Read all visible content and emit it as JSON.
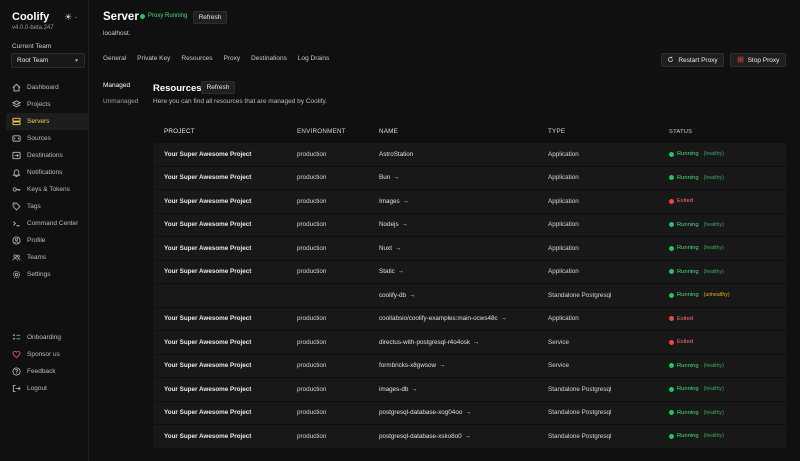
{
  "app": {
    "name": "Coolify",
    "version": "v4.0.0-beta.247"
  },
  "team": {
    "label": "Current Team",
    "value": "Root Team"
  },
  "nav": {
    "items": [
      {
        "label": "Dashboard",
        "icon": "home-icon"
      },
      {
        "label": "Projects",
        "icon": "layers-icon"
      },
      {
        "label": "Servers",
        "icon": "server-icon",
        "active": true
      },
      {
        "label": "Sources",
        "icon": "source-icon"
      },
      {
        "label": "Destinations",
        "icon": "destination-icon"
      },
      {
        "label": "Notifications",
        "icon": "bell-icon"
      },
      {
        "label": "Keys & Tokens",
        "icon": "key-icon"
      },
      {
        "label": "Tags",
        "icon": "tag-icon"
      },
      {
        "label": "Command Center",
        "icon": "terminal-icon"
      },
      {
        "label": "Profile",
        "icon": "user-icon"
      },
      {
        "label": "Teams",
        "icon": "users-icon"
      },
      {
        "label": "Settings",
        "icon": "gear-icon"
      }
    ],
    "bottom": [
      {
        "label": "Onboarding",
        "icon": "checklist-icon"
      },
      {
        "label": "Sponsor us",
        "icon": "heart-icon"
      },
      {
        "label": "Feedback",
        "icon": "help-icon"
      },
      {
        "label": "Logout",
        "icon": "logout-icon"
      }
    ]
  },
  "header": {
    "title": "Server",
    "proxy_status": "Proxy Running",
    "refresh_label": "Refresh",
    "host": "localhost."
  },
  "tabs": [
    "General",
    "Private Key",
    "Resources",
    "Proxy",
    "Destinations",
    "Log Drains"
  ],
  "actions": {
    "restart": "Restart Proxy",
    "stop": "Stop Proxy"
  },
  "subnav": [
    "Managed",
    "Unmanaged"
  ],
  "resources": {
    "title": "Resources",
    "refresh_label": "Refresh",
    "description": "Here you can find all resources that are managed by Coolify.",
    "columns": [
      "Project",
      "Environment",
      "Name",
      "Type",
      "Status"
    ],
    "rows": [
      {
        "project": "Your Super Awesome Project",
        "environment": "production",
        "name": "AstroStation",
        "arrow": "",
        "type": "Application",
        "status": "Running",
        "health": "(healthy)",
        "state": "running"
      },
      {
        "project": "Your Super Awesome Project",
        "environment": "production",
        "name": "Bun",
        "arrow": "→",
        "type": "Application",
        "status": "Running",
        "health": "(healthy)",
        "state": "running"
      },
      {
        "project": "Your Super Awesome Project",
        "environment": "production",
        "name": "Images",
        "arrow": "→",
        "type": "Application",
        "status": "Exited",
        "health": "",
        "state": "exited"
      },
      {
        "project": "Your Super Awesome Project",
        "environment": "production",
        "name": "Nodejs",
        "arrow": "→",
        "type": "Application",
        "status": "Running",
        "health": "(healthy)",
        "state": "running"
      },
      {
        "project": "Your Super Awesome Project",
        "environment": "production",
        "name": "Nuxt",
        "arrow": "→",
        "type": "Application",
        "status": "Running",
        "health": "(healthy)",
        "state": "running"
      },
      {
        "project": "Your Super Awesome Project",
        "environment": "production",
        "name": "Static",
        "arrow": "→",
        "type": "Application",
        "status": "Running",
        "health": "(healthy)",
        "state": "running"
      },
      {
        "project": "",
        "environment": "",
        "name": "coolify-db",
        "arrow": "→",
        "type": "Standalone Postgresql",
        "status": "Running",
        "health": "(unhealthy)",
        "state": "running-warn"
      },
      {
        "project": "Your Super Awesome Project",
        "environment": "production",
        "name": "coollabsio/coolify-examples:main-ocws48c",
        "arrow": "→",
        "type": "Application",
        "status": "Exited",
        "health": "",
        "state": "exited"
      },
      {
        "project": "Your Super Awesome Project",
        "environment": "production",
        "name": "directus-with-postgresql-r4o4osk",
        "arrow": "→",
        "type": "Service",
        "status": "Exited",
        "health": "",
        "state": "exited"
      },
      {
        "project": "Your Super Awesome Project",
        "environment": "production",
        "name": "formbricks-x8gwsow",
        "arrow": "→",
        "type": "Service",
        "status": "Running",
        "health": "(healthy)",
        "state": "running"
      },
      {
        "project": "Your Super Awesome Project",
        "environment": "production",
        "name": "images-db",
        "arrow": "→",
        "type": "Standalone Postgresql",
        "status": "Running",
        "health": "(healthy)",
        "state": "running"
      },
      {
        "project": "Your Super Awesome Project",
        "environment": "production",
        "name": "postgresql-database-xog04oo",
        "arrow": "→",
        "type": "Standalone Postgresql",
        "status": "Running",
        "health": "(healthy)",
        "state": "running"
      },
      {
        "project": "Your Super Awesome Project",
        "environment": "production",
        "name": "postgresql-database-xsko8o0",
        "arrow": "→",
        "type": "Standalone Postgresql",
        "status": "Running",
        "health": "(healthy)",
        "state": "running"
      }
    ]
  },
  "colors": {
    "accent": "#fcd452",
    "running": "#22c55e",
    "exited": "#ef4444",
    "unhealthy": "#eab308",
    "background": "#101010",
    "row": "#181818"
  }
}
